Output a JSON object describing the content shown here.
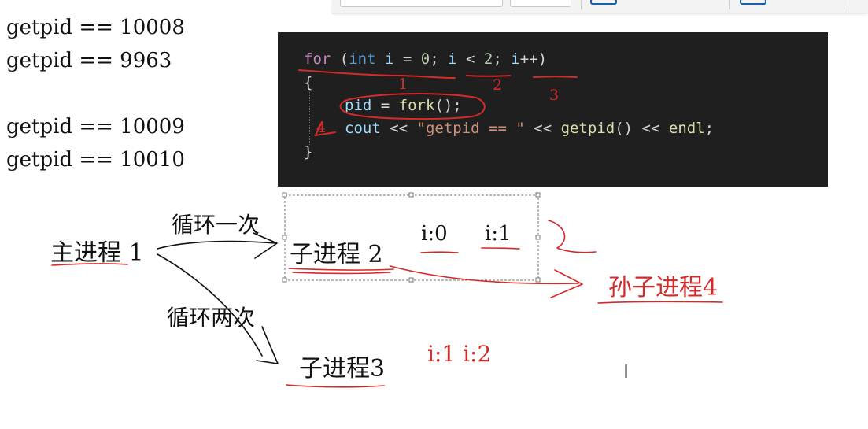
{
  "output": {
    "lines": [
      "getpid == 10008",
      "getpid == 9963",
      "getpid == 10009",
      "getpid == 10010"
    ]
  },
  "code": {
    "for_kw": "for",
    "paren_open": " (",
    "int_kw": "int",
    "var_i": "i",
    "eq_zero": " = ",
    "zero": "0",
    "semi1": "; ",
    "lt": " < ",
    "two": "2",
    "semi2": "; ",
    "incr": "++)",
    "brace_open": "{",
    "pid_var": "pid",
    "assign": " = ",
    "fork_fn": "fork",
    "fork_call_end": "();",
    "cout_var": "cout",
    "shift1": " << ",
    "str_literal": "\"getpid == \"",
    "shift2": " << ",
    "getpid_fn": "getpid",
    "call_paren": "()",
    "shift3": " << ",
    "endl": "endl",
    "semi3": ";",
    "brace_close": "}"
  },
  "annotations": {
    "hand_num_1": "1",
    "hand_num_2": "2",
    "hand_num_3": "3",
    "hand_num_4": "4"
  },
  "diagram": {
    "main_process": "主进程 1",
    "loop_once": "循环一次",
    "loop_twice": "循环两次",
    "child2": "子进程 2",
    "child2_i0": "i:0",
    "child2_i1": "i:1",
    "child3": "子进程3",
    "child3_vars": "i:1 i:2",
    "grandchild4": "孙子进程4"
  },
  "colors": {
    "code_bg": "#1f1f1f",
    "ink_red": "#d42a2a"
  }
}
